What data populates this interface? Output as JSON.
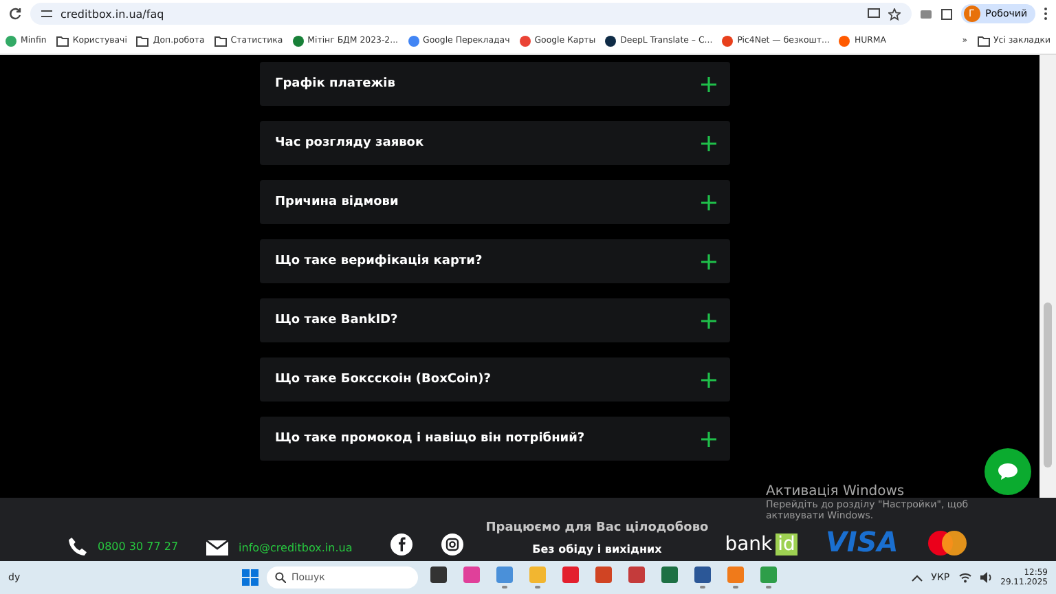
{
  "browser": {
    "url": "creditbox.in.ua/faq",
    "profile": {
      "initial": "Г",
      "name": "Робочий"
    }
  },
  "bookmarks": [
    {
      "kind": "site",
      "label": "Minfin"
    },
    {
      "kind": "folder",
      "label": "Користувачі"
    },
    {
      "kind": "folder",
      "label": "Доп.робота"
    },
    {
      "kind": "folder",
      "label": "Статистика"
    },
    {
      "kind": "sheet",
      "label": "Мітінг БДМ 2023-2..."
    },
    {
      "kind": "translate",
      "label": "Google Перекладач"
    },
    {
      "kind": "maps",
      "label": "Google Карты"
    },
    {
      "kind": "deepl",
      "label": "DeepL Translate – C..."
    },
    {
      "kind": "pic",
      "label": "Pic4Net — безкошт..."
    },
    {
      "kind": "hurma",
      "label": "HURMA"
    }
  ],
  "bookmarks_overflow": "»",
  "all_bookmarks": "Усі закладки",
  "faq": [
    {
      "question": "Графік платежів",
      "expanded": false
    },
    {
      "question": "Час розгляду заявок",
      "expanded": false
    },
    {
      "question": "Причина відмови",
      "expanded": false
    },
    {
      "question": "Що таке верифікація карти?",
      "expanded": false
    },
    {
      "question": "Що таке BankID?",
      "expanded": false
    },
    {
      "question": "Що таке Боксскоін (BoxCoin)?",
      "expanded": false
    },
    {
      "question": "Що таке промокод і навіщо він потрібний?",
      "expanded": false
    }
  ],
  "footer": {
    "phone": "0800 30 77 27",
    "email": "info@creditbox.in.ua",
    "hours_title": "Працюємо для Вас цілодобово",
    "hours_note": "Без обіду і вихідних",
    "bankid": {
      "word": "bank",
      "badge": "id"
    },
    "visa": "VISA"
  },
  "activation": {
    "title": "Активація Windows",
    "text": "Перейдіть до розділу \"Настройки\", щоб активувати Windows."
  },
  "taskbar": {
    "weather": "dy",
    "search_placeholder": "Пошук",
    "apps": [
      {
        "kind": "taskview",
        "running": false
      },
      {
        "kind": "photos",
        "running": false
      },
      {
        "kind": "snip",
        "running": true
      },
      {
        "kind": "folder",
        "running": true
      },
      {
        "kind": "opera",
        "running": false
      },
      {
        "kind": "powerpoint",
        "running": false
      },
      {
        "kind": "pdf",
        "running": false
      },
      {
        "kind": "excel",
        "running": false
      },
      {
        "kind": "word",
        "running": true
      },
      {
        "kind": "firefox",
        "running": true
      },
      {
        "kind": "chrome",
        "running": true
      }
    ],
    "language": "УКР",
    "time": "12:59",
    "date": "29.11.2025"
  }
}
